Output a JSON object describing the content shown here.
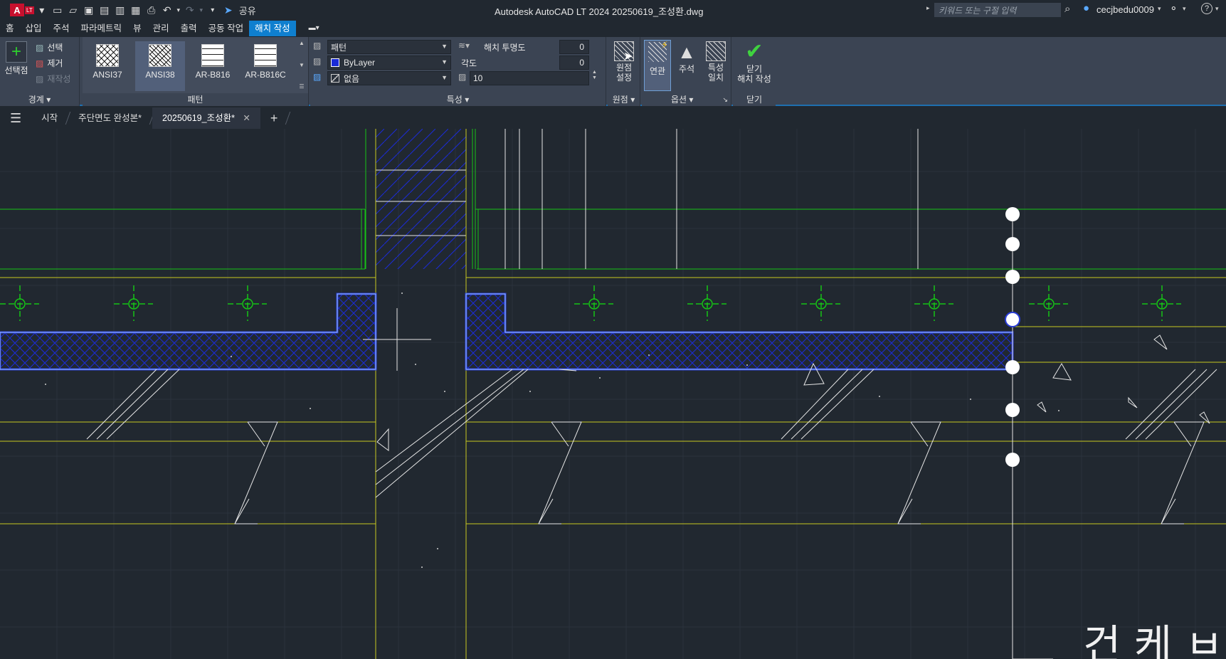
{
  "titlebar": {
    "logo_text": "A",
    "logo_sub": "LT",
    "share_label": "공유",
    "title": "Autodesk AutoCAD LT 2024    20250619_조성환.dwg",
    "search_placeholder": "키워드 또는 구절 입력",
    "user": "cecjbedu0009"
  },
  "ribbon_tabs": [
    "홈",
    "삽입",
    "주석",
    "파라메트릭",
    "뷰",
    "관리",
    "출력",
    "공동 작업",
    "해치 작성"
  ],
  "ribbon_active_tab": "해치 작성",
  "boundary_panel": {
    "label": "경계",
    "pick_point": "선택점",
    "select": "선택",
    "remove": "제거",
    "recreate": "재작성"
  },
  "pattern_panel": {
    "label": "패턴",
    "patterns": [
      "ANSI37",
      "ANSI38",
      "AR-B816",
      "AR-B816C"
    ]
  },
  "properties_panel": {
    "label": "특성",
    "hatch_type": "패턴",
    "color": "ByLayer",
    "background": "없음",
    "transparency_label": "해치 투명도",
    "transparency_value": "0",
    "angle_label": "각도",
    "angle_value": "0",
    "scale_value": "10"
  },
  "origin_panel": {
    "label": "원점",
    "set_origin": "원점\n설정"
  },
  "options_panel": {
    "label": "옵션",
    "associative": "연관",
    "annotative": "주석",
    "match_props": "특성\n일치"
  },
  "close_panel": {
    "label": "닫기",
    "close_button": "닫기\n해치 작성"
  },
  "file_tabs": {
    "start": "시작",
    "tab1": "주단면도 완성본*",
    "tab2": "20250619_조성환*"
  },
  "canvas_text": "건 케 ㅂ",
  "colors": {
    "background": "#212830",
    "ribbon": "#3b4453",
    "accent": "#0f7fcf",
    "hatch_blue": "#1a2bd8",
    "green_line": "#16c416",
    "yellow_line": "#c8c820"
  }
}
